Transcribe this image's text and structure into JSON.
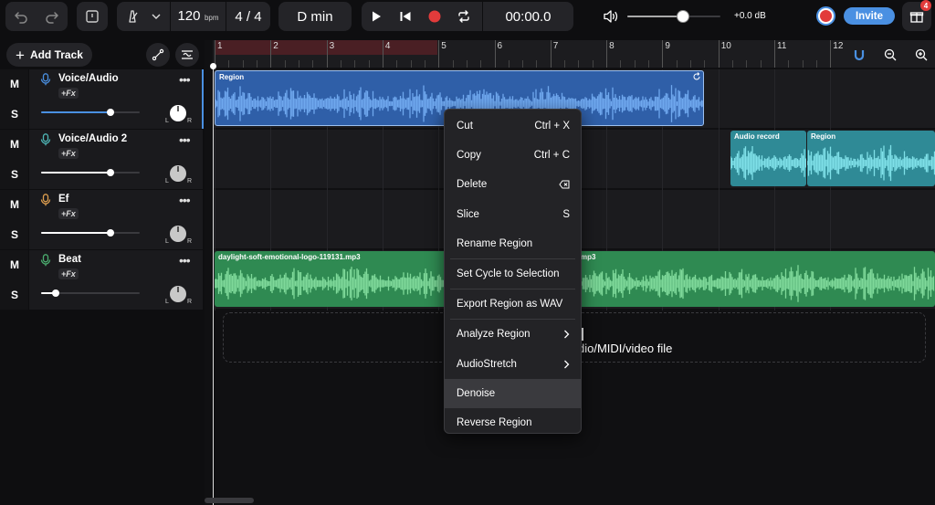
{
  "toolbar": {
    "tempo": "120",
    "tempo_unit": "bpm",
    "time_signature": "4 / 4",
    "key": "D min",
    "time_display": "00:00.0",
    "volume_db": "+0.0 dB",
    "master_volume_level": 0.6,
    "invite_label": "Invite",
    "gift_badge": "4"
  },
  "tracks_panel": {
    "add_track_label": "Add Track",
    "mute_label": "M",
    "solo_label": "S",
    "pan_l": "L",
    "pan_r": "R",
    "tracks": [
      {
        "name": "Voice/Audio",
        "fx": "+Fx",
        "icon": "mic-icon",
        "icon_color": "#4a90e2",
        "volume": 0.7,
        "selected": true
      },
      {
        "name": "Voice/Audio 2",
        "fx": "+Fx",
        "icon": "mic-icon",
        "icon_color": "#4fb8b8",
        "volume": 0.7,
        "selected": false
      },
      {
        "name": "Ef",
        "fx": "+Fx",
        "icon": "mic-icon",
        "icon_color": "#e0a050",
        "volume": 0.7,
        "selected": false
      },
      {
        "name": "Beat",
        "fx": "+Fx",
        "icon": "mic-icon",
        "icon_color": "#4caf70",
        "volume": 0.15,
        "selected": false
      }
    ]
  },
  "timeline": {
    "bars": [
      "1",
      "2",
      "3",
      "4",
      "5",
      "6",
      "7",
      "8",
      "9",
      "10",
      "11",
      "12"
    ],
    "regions": {
      "track1_region": "Region",
      "track2_audio_record": "Audio record",
      "track2_region": "Region",
      "track4_region_left": "daylight-soft-emotional-logo-119131.mp3",
      "track4_region_right": "mp3"
    },
    "drop_zone_text": "dio/MIDI/video file"
  },
  "context_menu": {
    "items": [
      {
        "label": "Cut",
        "shortcut": "Ctrl + X"
      },
      {
        "label": "Copy",
        "shortcut": "Ctrl + C"
      },
      {
        "label": "Delete",
        "shortcut": ""
      },
      {
        "label": "Slice",
        "shortcut": "S"
      },
      {
        "label": "Rename Region",
        "shortcut": ""
      },
      {
        "label": "Set Cycle to Selection",
        "shortcut": ""
      },
      {
        "label": "Export Region as WAV",
        "shortcut": ""
      },
      {
        "label": "Analyze Region",
        "shortcut": ""
      },
      {
        "label": "AudioStretch",
        "shortcut": ""
      },
      {
        "label": "Denoise",
        "shortcut": ""
      },
      {
        "label": "Reverse Region",
        "shortcut": ""
      }
    ]
  },
  "colors": {
    "accent_blue": "#4a90e2",
    "region_blue": "#2f5fa8",
    "region_teal": "#2f8a96",
    "region_green": "#2f8a52",
    "record_red": "#e23b3b",
    "invite_blue": "#4a90e2"
  }
}
